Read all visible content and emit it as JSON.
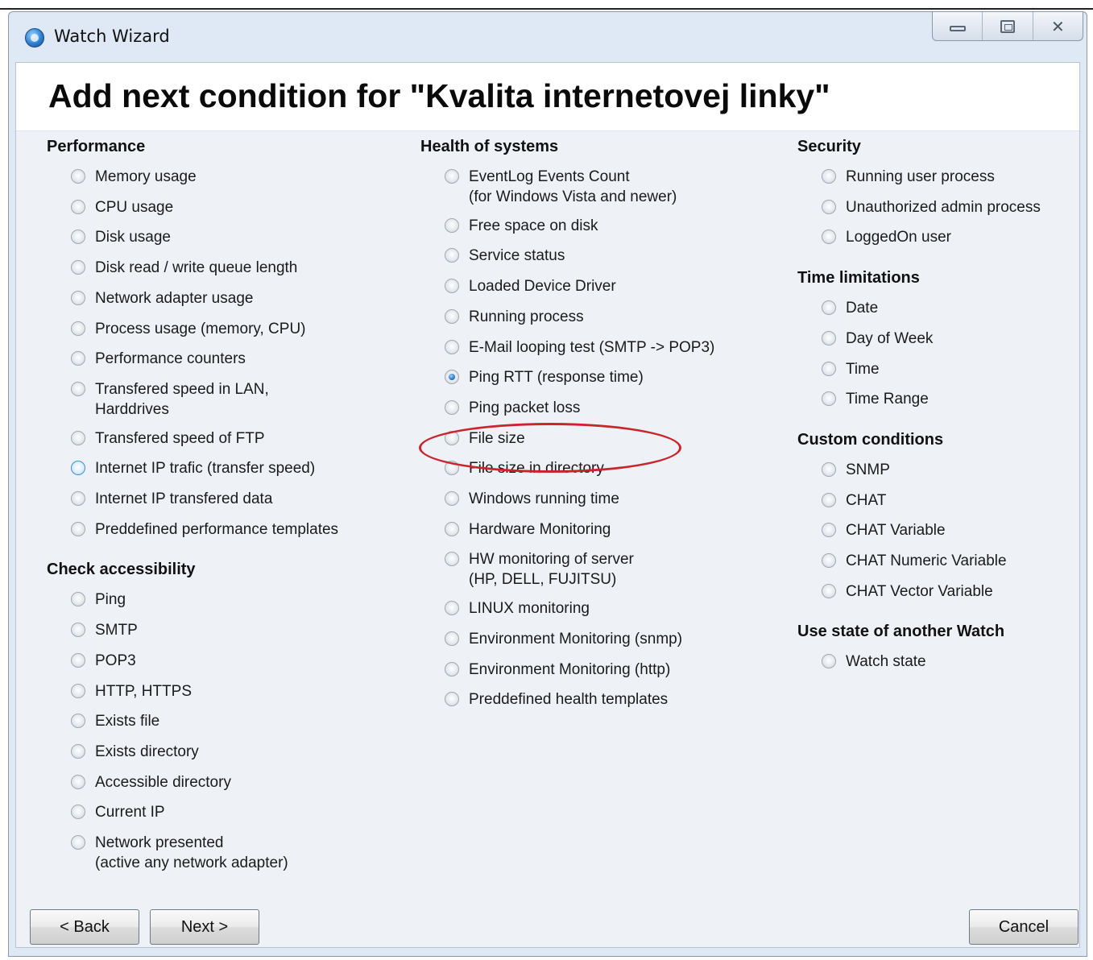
{
  "window": {
    "title": "Watch Wizard"
  },
  "page": {
    "title": "Add next condition for \"Kvalita internetovej linky\""
  },
  "columns": [
    {
      "sections": [
        {
          "title": "Performance",
          "options": [
            {
              "label": "Memory usage"
            },
            {
              "label": "CPU usage"
            },
            {
              "label": "Disk usage"
            },
            {
              "label": "Disk read / write queue length"
            },
            {
              "label": "Network adapter usage"
            },
            {
              "label": "Process usage (memory, CPU)"
            },
            {
              "label": "Performance counters"
            },
            {
              "label": "Transfered speed in LAN,",
              "sub": "Harddrives"
            },
            {
              "label": "Transfered speed of FTP"
            },
            {
              "label": "Internet IP trafic (transfer speed)",
              "focused": true
            },
            {
              "label": "Internet IP transfered data"
            },
            {
              "label": "Preddefined performance templates"
            }
          ]
        },
        {
          "title": "Check accessibility",
          "options": [
            {
              "label": "Ping"
            },
            {
              "label": "SMTP"
            },
            {
              "label": "POP3"
            },
            {
              "label": "HTTP, HTTPS"
            },
            {
              "label": "Exists file"
            },
            {
              "label": "Exists directory"
            },
            {
              "label": "Accessible directory"
            },
            {
              "label": "Current IP"
            },
            {
              "label": "Network presented",
              "sub": "(active any network adapter)"
            }
          ]
        }
      ]
    },
    {
      "sections": [
        {
          "title": "Health of systems",
          "options": [
            {
              "label": "EventLog Events Count",
              "sub": "(for Windows Vista and newer)"
            },
            {
              "label": "Free space on disk"
            },
            {
              "label": "Service status"
            },
            {
              "label": "Loaded Device Driver"
            },
            {
              "label": "Running process"
            },
            {
              "label": "E-Mail looping test (SMTP -> POP3)"
            },
            {
              "label": "Ping RTT (response time)",
              "checked": true
            },
            {
              "label": "Ping packet loss"
            },
            {
              "label": "File size"
            },
            {
              "label": "File size in directory"
            },
            {
              "label": "Windows running time"
            },
            {
              "label": "Hardware Monitoring"
            },
            {
              "label": "HW monitoring of server",
              "sub": "(HP, DELL, FUJITSU)"
            },
            {
              "label": "LINUX monitoring"
            },
            {
              "label": "Environment Monitoring (snmp)"
            },
            {
              "label": "Environment Monitoring (http)"
            },
            {
              "label": "Preddefined health templates"
            }
          ]
        }
      ]
    },
    {
      "sections": [
        {
          "title": "Security",
          "options": [
            {
              "label": "Running user process"
            },
            {
              "label": "Unauthorized admin process"
            },
            {
              "label": "LoggedOn user"
            }
          ]
        },
        {
          "title": "Time limitations",
          "options": [
            {
              "label": "Date"
            },
            {
              "label": "Day of Week"
            },
            {
              "label": "Time"
            },
            {
              "label": "Time Range"
            }
          ]
        },
        {
          "title": "Custom conditions",
          "options": [
            {
              "label": "SNMP"
            },
            {
              "label": "CHAT"
            },
            {
              "label": "CHAT Variable"
            },
            {
              "label": "CHAT Numeric Variable"
            },
            {
              "label": "CHAT Vector Variable"
            }
          ]
        },
        {
          "title": "Use state of another Watch",
          "options": [
            {
              "label": "Watch state"
            }
          ]
        }
      ]
    }
  ],
  "buttons": {
    "back": "< Back",
    "next": "Next >",
    "cancel": "Cancel"
  },
  "colors": {
    "highlight_ring": "#c8262c",
    "options_background": "#eef2f7"
  }
}
